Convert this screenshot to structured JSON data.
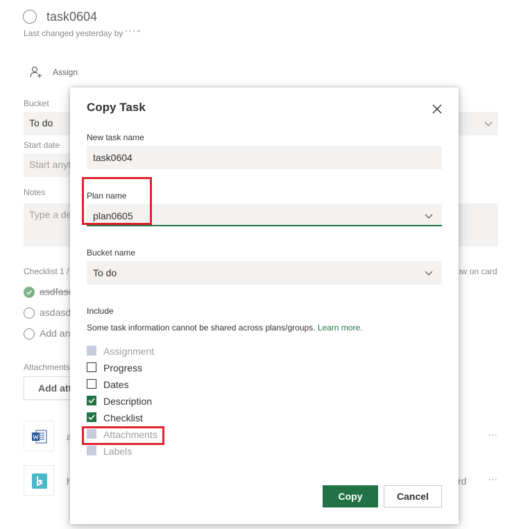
{
  "task": {
    "title": "task0604",
    "last_changed": "Last changed yesterday by",
    "changed_by": "' ' '  ''",
    "assign_label": "Assign"
  },
  "background": {
    "bucket_label": "Bucket",
    "bucket_value": "To do",
    "start_date_label": "Start date",
    "start_date_placeholder": "Start anyt",
    "notes_label": "Notes",
    "notes_placeholder": "Type a de",
    "checklist_label": "Checklist 1 /",
    "show_on_card": "ow on card",
    "checklist_items": [
      "asdfasc",
      "asdasdf",
      "Add an"
    ],
    "attachments_label": "Attachments",
    "add_attachment": "Add att",
    "attachment_right_text": "rd",
    "attachment_left_texts": [
      "a",
      "h"
    ]
  },
  "dialog": {
    "title": "Copy Task",
    "new_task_name_label": "New task name",
    "new_task_name_value": "task0604",
    "plan_name_label": "Plan name",
    "plan_name_value": "plan0605",
    "bucket_name_label": "Bucket name",
    "bucket_name_value": "To do",
    "include_label": "Include",
    "note_text": "Some task information cannot be shared across plans/groups.",
    "learn_more": "Learn more.",
    "include_options": [
      {
        "label": "Assignment",
        "state": "disabled"
      },
      {
        "label": "Progress",
        "state": "unchecked"
      },
      {
        "label": "Dates",
        "state": "unchecked"
      },
      {
        "label": "Description",
        "state": "checked"
      },
      {
        "label": "Checklist",
        "state": "checked"
      },
      {
        "label": "Attachments",
        "state": "disabled"
      },
      {
        "label": "Labels",
        "state": "disabled"
      }
    ],
    "copy_button": "Copy",
    "cancel_button": "Cancel"
  },
  "colors": {
    "accent": "#217346",
    "highlight": "#e0242f",
    "disabled_checkbox": "#c8cbdc"
  },
  "icons": [
    "person-add-icon",
    "close-icon",
    "chevron-down-icon",
    "checkmark-icon",
    "word-doc-icon",
    "bing-icon",
    "more-icon"
  ]
}
